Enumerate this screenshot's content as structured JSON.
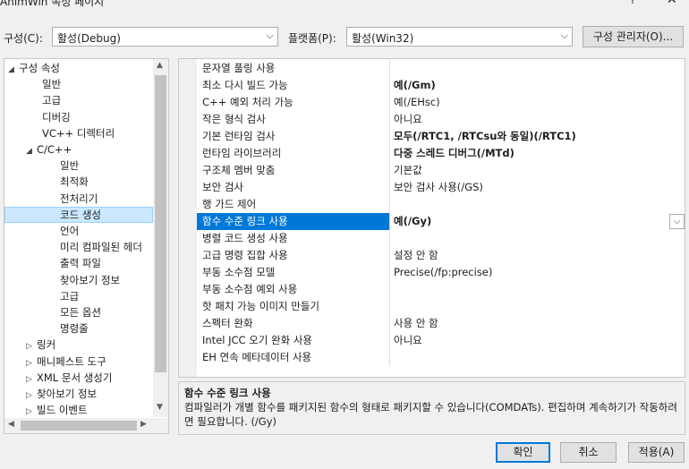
{
  "window": {
    "title": "AnimWin 속성 페이지",
    "help": "?",
    "close": "✕"
  },
  "toolbar": {
    "config_label": "구성(C):",
    "config_value": "활성(Debug)",
    "platform_label": "플랫폼(P):",
    "platform_value": "활성(Win32)",
    "config_manager": "구성 관리자(O)..."
  },
  "tree": {
    "items": [
      {
        "label": "구성 속성",
        "expander": "◢"
      },
      {
        "label": "일반",
        "expander": ""
      },
      {
        "label": "고급",
        "expander": ""
      },
      {
        "label": "디버깅",
        "expander": ""
      },
      {
        "label": "VC++ 디렉터리",
        "expander": ""
      },
      {
        "label": "C/C++",
        "expander": "◢"
      },
      {
        "label": "일반",
        "expander": ""
      },
      {
        "label": "최적화",
        "expander": ""
      },
      {
        "label": "전처리기",
        "expander": ""
      },
      {
        "label": "코드 생성",
        "expander": ""
      },
      {
        "label": "언어",
        "expander": ""
      },
      {
        "label": "미리 컴파일된 헤더",
        "expander": ""
      },
      {
        "label": "출력 파일",
        "expander": ""
      },
      {
        "label": "찾아보기 정보",
        "expander": ""
      },
      {
        "label": "고급",
        "expander": ""
      },
      {
        "label": "모든 옵션",
        "expander": ""
      },
      {
        "label": "명령줄",
        "expander": ""
      },
      {
        "label": "링커",
        "expander": "▷"
      },
      {
        "label": "매니페스트 도구",
        "expander": "▷"
      },
      {
        "label": "XML 문서 생성기",
        "expander": "▷"
      },
      {
        "label": "찾아보기 정보",
        "expander": "▷"
      },
      {
        "label": "빌드 이벤트",
        "expander": "▷"
      }
    ],
    "selected_index": 9
  },
  "properties": [
    {
      "name": "문자열 풀링 사용",
      "value": "",
      "bold": false
    },
    {
      "name": "최소 다시 빌드 가능",
      "value": "예(/Gm)",
      "bold": true
    },
    {
      "name": "C++ 예외 처리 가능",
      "value": "예(/EHsc)",
      "bold": false
    },
    {
      "name": "작은 형식 검사",
      "value": "아니요",
      "bold": false
    },
    {
      "name": "기본 런타임 검사",
      "value": "모두(/RTC1, /RTCsu와 동일)(/RTC1)",
      "bold": true
    },
    {
      "name": "런타임 라이브러리",
      "value": "다중 스레드 디버그(/MTd)",
      "bold": true
    },
    {
      "name": "구조체 멤버 맞춤",
      "value": "기본값",
      "bold": false
    },
    {
      "name": "보안 검사",
      "value": "보안 검사 사용(/GS)",
      "bold": false
    },
    {
      "name": "행 가드 제어",
      "value": "",
      "bold": false
    },
    {
      "name": "함수 수준 링크 사용",
      "value": "예(/Gy)",
      "bold": true
    },
    {
      "name": "병렬 코드 생성 사용",
      "value": "",
      "bold": false
    },
    {
      "name": "고급 명령 집합 사용",
      "value": "설정 안 함",
      "bold": false
    },
    {
      "name": "부동 소수점 모델",
      "value": "Precise(/fp:precise)",
      "bold": false
    },
    {
      "name": "부동 소수점 예외 사용",
      "value": "",
      "bold": false
    },
    {
      "name": "핫 패치 가능 이미지 만들기",
      "value": "",
      "bold": false
    },
    {
      "name": "스펙터 완화",
      "value": "사용 안 함",
      "bold": false
    },
    {
      "name": "Intel JCC 오기 완화 사용",
      "value": "아니요",
      "bold": false
    },
    {
      "name": "EH 연속 메타데이터 사용",
      "value": "",
      "bold": false
    }
  ],
  "selected_property": 9,
  "description": {
    "title": "함수 수준 링크 사용",
    "text": "컴파일러가 개별 함수를 패키지된 함수의 형태로 패키지할 수 있습니다(COMDATs). 편집하며 계속하기가 작동하려면 필요합니다.     (/Gy)"
  },
  "buttons": {
    "ok": "확인",
    "cancel": "취소",
    "apply": "적용(A)"
  },
  "colors": {
    "selection": "#0078d7",
    "tree_selection": "#cce8ff"
  }
}
